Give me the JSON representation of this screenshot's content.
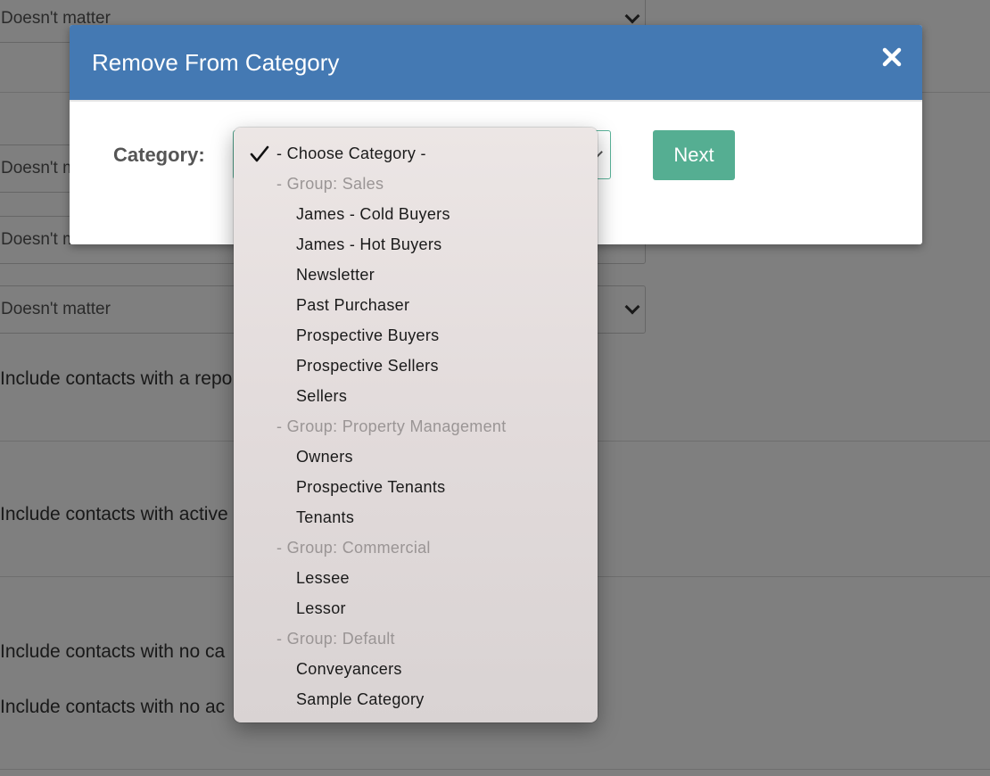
{
  "background": {
    "select_values": [
      "Doesn't matter",
      "Doesn't m",
      "Doesn't matter",
      "Doesn't matter"
    ],
    "texts": [
      "Include contacts with a repo",
      "Include contacts with active",
      "Include contacts with no ca",
      "Include contacts with no ac"
    ]
  },
  "modal": {
    "title": "Remove From Category",
    "close_icon": "close-icon",
    "category_label": "Category:",
    "next_label": "Next",
    "accent_color": "#4479b3",
    "button_color": "#55ae92"
  },
  "dropdown": {
    "options": [
      {
        "label": "- Choose Category -",
        "kind": "selected"
      },
      {
        "label": "- Group: Sales",
        "kind": "group"
      },
      {
        "label": "James - Cold Buyers",
        "kind": "item"
      },
      {
        "label": "James - Hot Buyers",
        "kind": "item"
      },
      {
        "label": "Newsletter",
        "kind": "item"
      },
      {
        "label": "Past Purchaser",
        "kind": "item"
      },
      {
        "label": "Prospective Buyers",
        "kind": "item"
      },
      {
        "label": "Prospective Sellers",
        "kind": "item"
      },
      {
        "label": "Sellers",
        "kind": "item"
      },
      {
        "label": "- Group: Property Management",
        "kind": "group"
      },
      {
        "label": "Owners",
        "kind": "item"
      },
      {
        "label": "Prospective Tenants",
        "kind": "item"
      },
      {
        "label": "Tenants",
        "kind": "item"
      },
      {
        "label": "- Group: Commercial",
        "kind": "group"
      },
      {
        "label": "Lessee",
        "kind": "item"
      },
      {
        "label": "Lessor",
        "kind": "item"
      },
      {
        "label": "- Group: Default",
        "kind": "group"
      },
      {
        "label": "Conveyancers",
        "kind": "item"
      },
      {
        "label": "Sample Category",
        "kind": "item"
      }
    ]
  }
}
